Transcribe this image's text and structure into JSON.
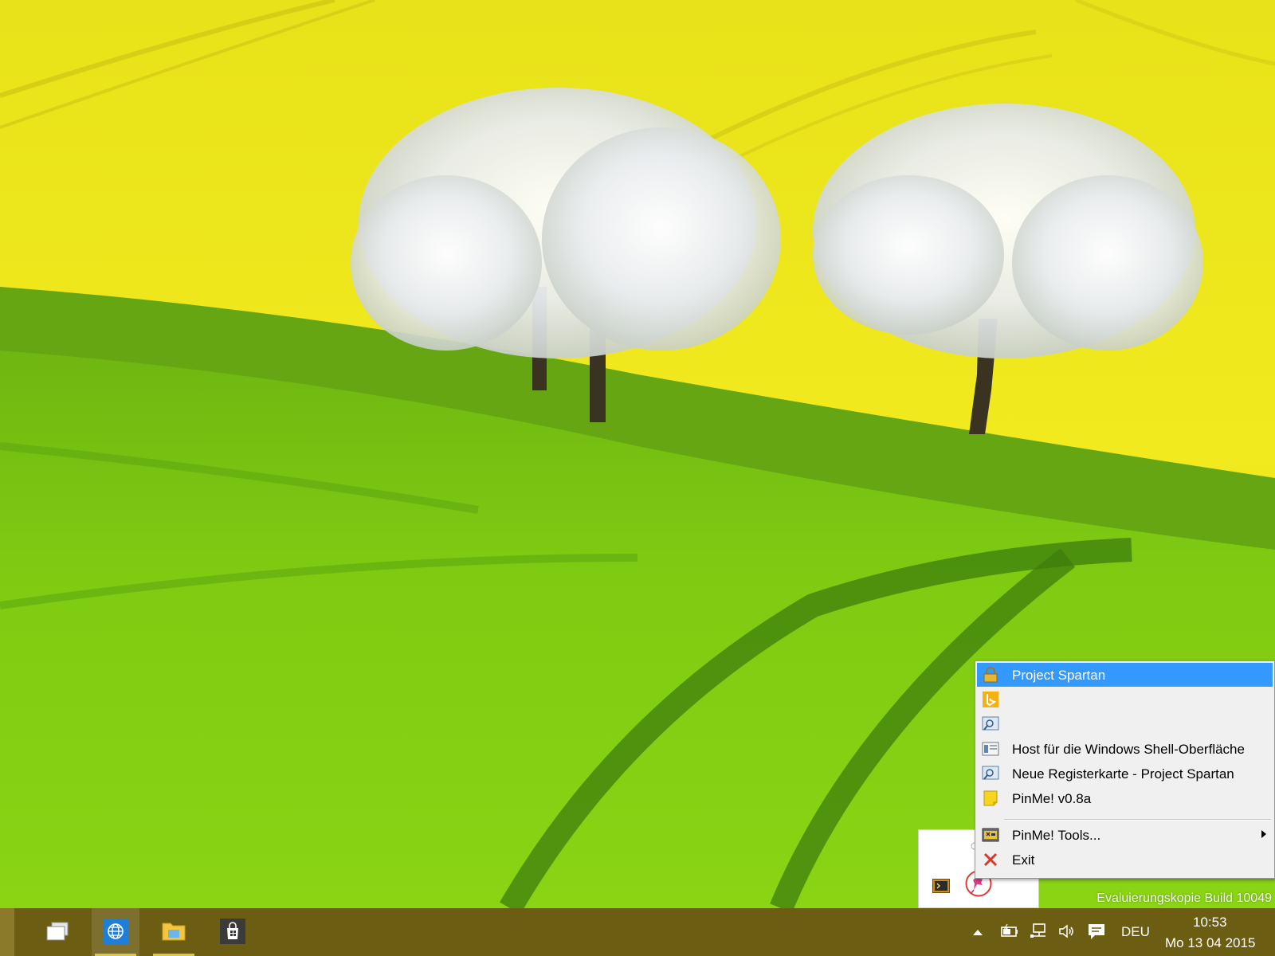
{
  "desktop": {
    "watermark": "Evaluierungskopie Build 10049"
  },
  "context_menu": {
    "items": [
      {
        "label": "Project Spartan",
        "icon": "lock-icon",
        "selected": true
      },
      {
        "label": "",
        "icon": "bing-icon"
      },
      {
        "label": "",
        "icon": "search-window-icon"
      },
      {
        "label": "Host für die Windows Shell-Oberfläche",
        "icon": "shell-host-icon"
      },
      {
        "label": "Neue Registerkarte - Project Spartan",
        "icon": "search-window-icon"
      },
      {
        "label": "PinMe! v0.8a",
        "icon": "note-icon"
      },
      {
        "label": "PinMe! Tools...",
        "icon": "tools-icon",
        "has_submenu": true
      },
      {
        "label": "Exit",
        "icon": "close-x-icon"
      }
    ],
    "selected_color": "#3399ff"
  },
  "tray_overflow": {
    "icons": [
      "console-app-icon",
      "pinme-pushpin-icon"
    ]
  },
  "taskbar": {
    "color": "#6b5d12",
    "pinned": [
      "task-view-icon",
      "browser-globe-icon",
      "file-explorer-icon",
      "store-icon"
    ],
    "tray_icons": [
      "show-hidden-icons-chevron",
      "battery-icon",
      "network-icon",
      "volume-icon",
      "action-center-icon"
    ],
    "language": "DEU",
    "time": "10:53",
    "date": "Mo 13 04 2015"
  }
}
